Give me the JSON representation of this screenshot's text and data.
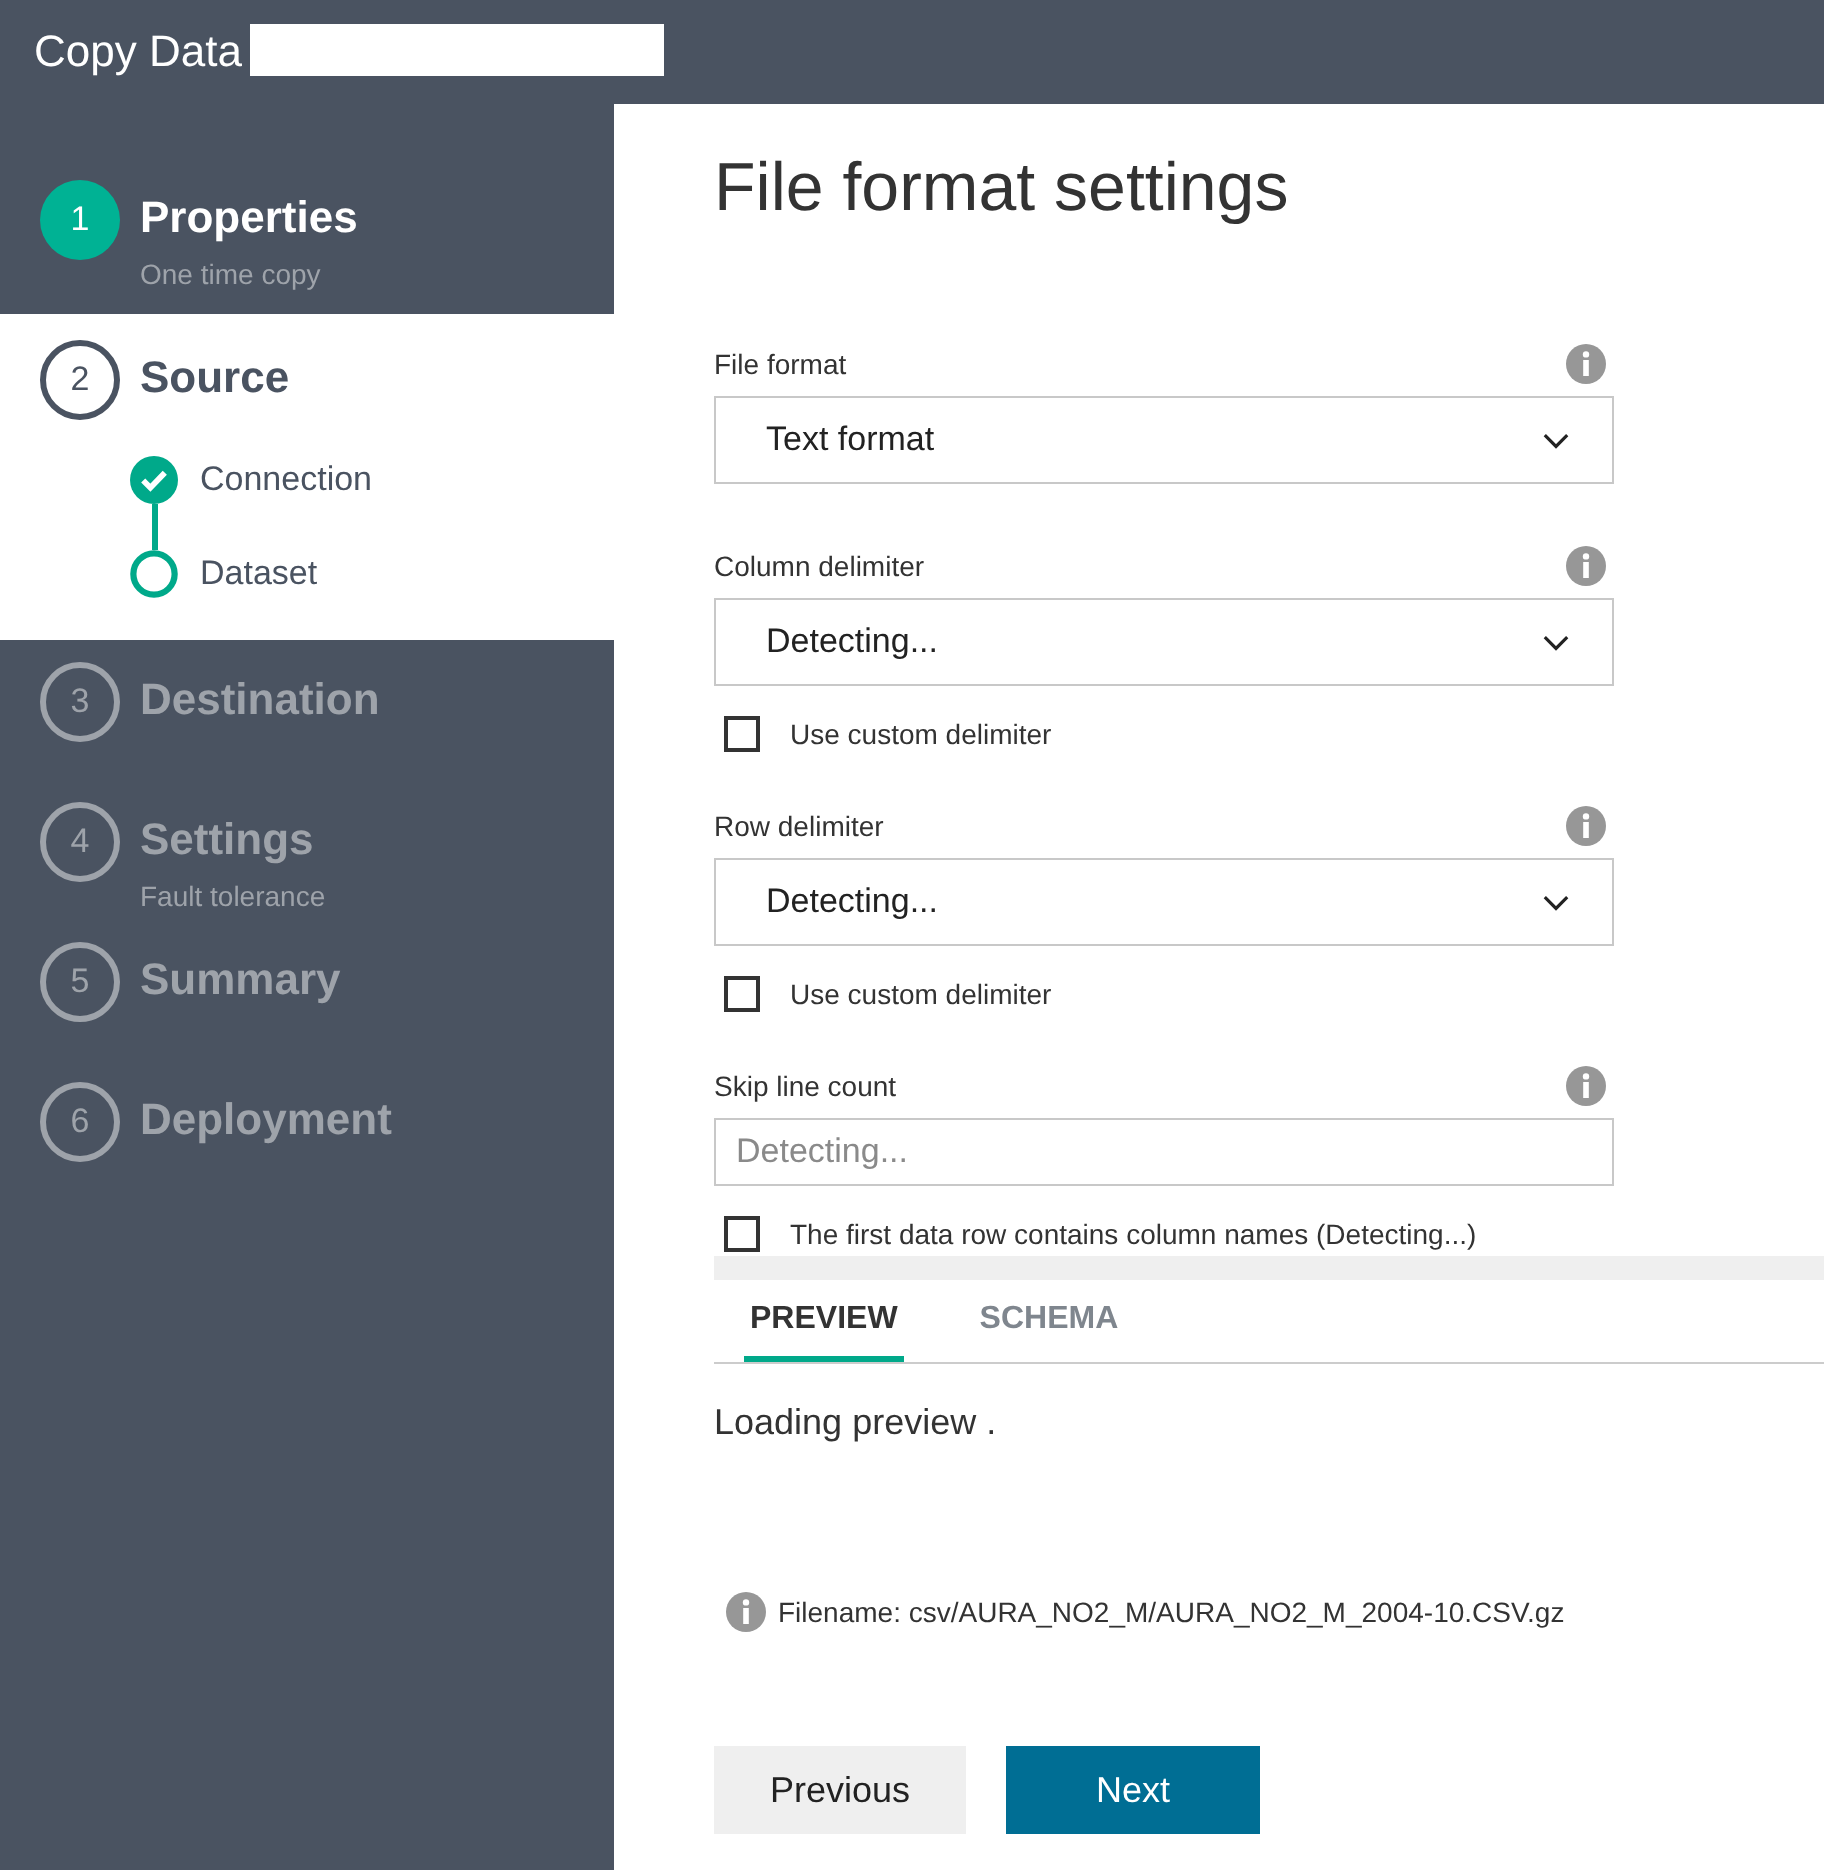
{
  "app": {
    "title": "Copy Data"
  },
  "steps": [
    {
      "number": "1",
      "title": "Properties",
      "subtitle": "One time copy",
      "done": true,
      "current": false
    },
    {
      "number": "2",
      "title": "Source",
      "current": true,
      "substeps": [
        {
          "label": "Connection",
          "done": true
        },
        {
          "label": "Dataset",
          "done": false
        }
      ]
    },
    {
      "number": "3",
      "title": "Destination",
      "done": false,
      "current": false
    },
    {
      "number": "4",
      "title": "Settings",
      "subtitle": "Fault tolerance",
      "done": false,
      "current": false
    },
    {
      "number": "5",
      "title": "Summary",
      "done": false,
      "current": false
    },
    {
      "number": "6",
      "title": "Deployment",
      "done": false,
      "current": false
    }
  ],
  "form": {
    "title": "File format settings",
    "items": [
      {
        "kind": "select",
        "label": "File format",
        "value": "Text format"
      },
      {
        "kind": "select",
        "label": "Column delimiter",
        "value": "Detecting..."
      },
      {
        "kind": "checkbox",
        "label": "Use custom delimiter",
        "checked": false
      },
      {
        "kind": "select",
        "label": "Row delimiter",
        "value": "Detecting..."
      },
      {
        "kind": "checkbox",
        "label": "Use custom delimiter",
        "checked": false
      },
      {
        "kind": "input",
        "label": "Skip line count",
        "placeholder": "Detecting..."
      },
      {
        "kind": "checkbox",
        "label": "The first data row contains column names (Detecting...)",
        "checked": false
      }
    ]
  },
  "tabs": [
    {
      "label": "PREVIEW",
      "selected": true
    },
    {
      "label": "SCHEMA",
      "selected": false
    }
  ],
  "preview": {
    "status": "Loading preview .",
    "filename": "Filename: csv/AURA_NO2_M/AURA_NO2_M_2004-10.CSV.gz"
  },
  "buttons": [
    {
      "label": "Previous",
      "kind": "secondary"
    },
    {
      "label": "Next",
      "kind": "primary"
    }
  ]
}
